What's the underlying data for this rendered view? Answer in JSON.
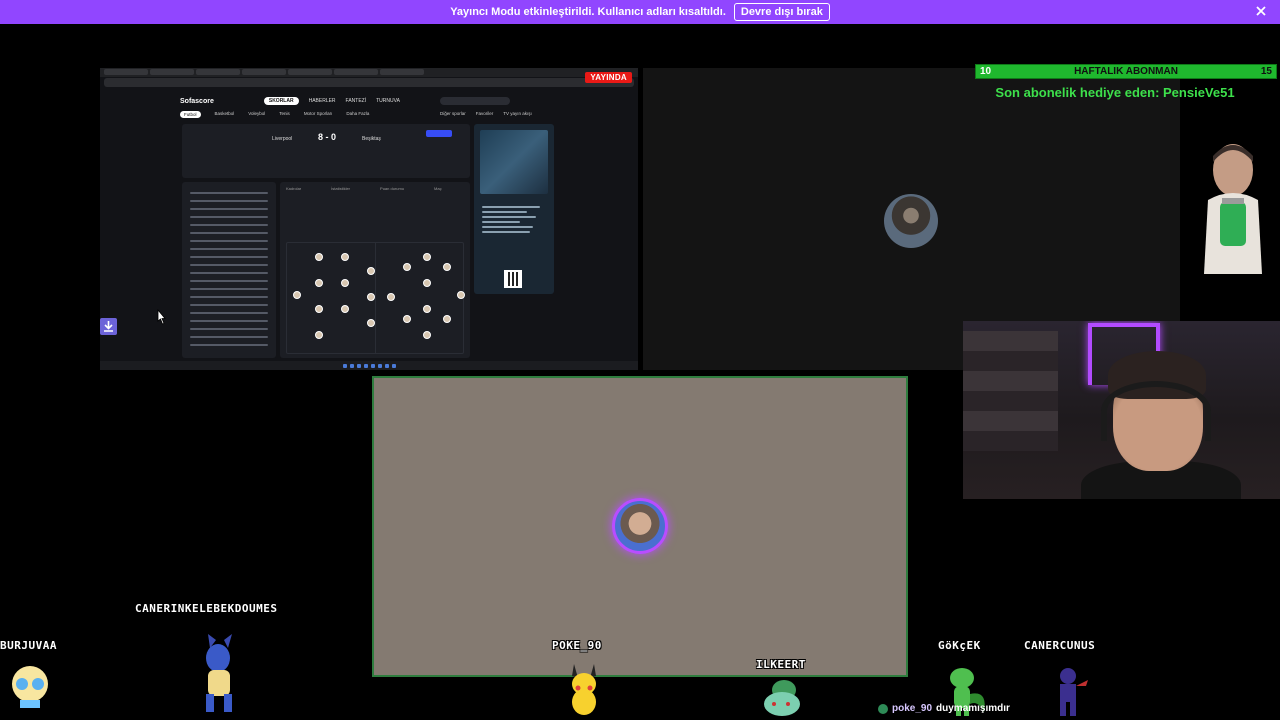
{
  "banner": {
    "message": "Yayıncı Modu etkinleştirildi. Kullanıcı adları kısaltıldı.",
    "disable_label": "Devre dışı bırak",
    "color": "#9146ff"
  },
  "stream_screen": {
    "live_badge": "YAYINDA",
    "site_logo": "Sofascore",
    "nav": [
      "SKORLAR",
      "HABERLER",
      "FANTEZİ",
      "TURNUVA"
    ],
    "sports": [
      "Futbol",
      "Basketbol",
      "Voleybol",
      "Tenis",
      "Motor Sporları",
      "Daha Fazla"
    ],
    "right_links": [
      "Diğer sporlar",
      "Favoriler",
      "TV yayın akışı"
    ],
    "match": {
      "home": "Liverpool",
      "away": "Beşiktaş",
      "score": "8 - 0"
    },
    "pitch_tabs": [
      "Kadrolar",
      "İstatistikler",
      "Puan durumu",
      "Maç"
    ]
  },
  "goal_bar": {
    "min": "10",
    "title": "HAFTALIK ABONMAN",
    "max": "15",
    "progress": 0.0
  },
  "last_gift": "Son abonelik hediye eden: PensieVe51",
  "pets": [
    {
      "name": "BURJUVAA",
      "icon": "bubble-girl-sprite"
    },
    {
      "name": "CANERINKELEBEKDOUMES",
      "icon": "lucario-sprite"
    },
    {
      "name": "POKE_90",
      "icon": "pikachu-sprite"
    },
    {
      "name": "ILKEERT",
      "icon": "bulbasaur-sprite"
    },
    {
      "name": "GöKçEK",
      "icon": "treecko-sprite"
    },
    {
      "name": "CANERCUNUS",
      "icon": "ninja-sprite"
    }
  ],
  "chat": {
    "user": "poke_90",
    "message": "duymamışımdır"
  },
  "colors": {
    "goal_green": "#1fb82e",
    "gift_text": "#3de04b",
    "discord_panel": "#847a71",
    "speaker_ring": "#b94dff",
    "live_red": "#e91916"
  }
}
